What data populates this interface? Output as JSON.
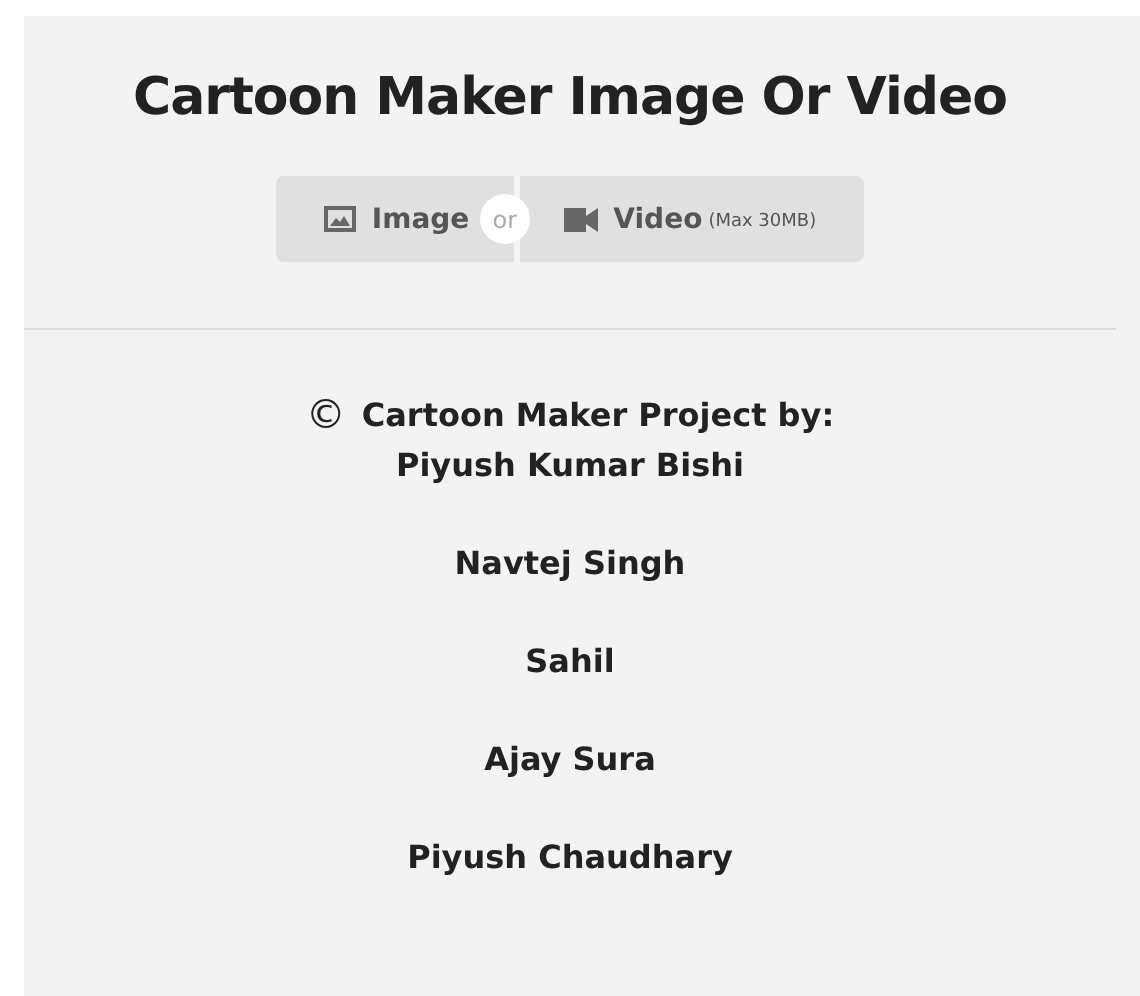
{
  "title": "Cartoon Maker Image Or Video",
  "buttons": [
    {
      "kind": "image",
      "label": "Image"
    },
    {
      "kind": "video",
      "label": "Video",
      "note": "(Max 30MB)"
    }
  ],
  "separator": "or",
  "credits": {
    "symbol": "©",
    "heading": "Cartoon Maker Project by:",
    "names": [
      "Piyush Kumar Bishi",
      "Navtej Singh",
      "Sahil",
      "Ajay Sura",
      "Piyush Chaudhary"
    ]
  }
}
